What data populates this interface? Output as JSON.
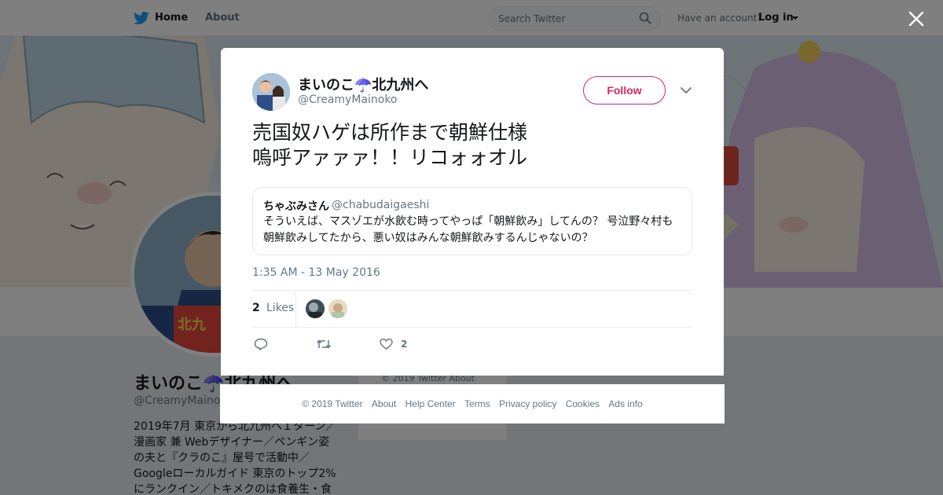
{
  "topnav": {
    "home_label": "Home",
    "about_label": "About",
    "search_placeholder": "Search Twitter",
    "have_account": "Have an account?",
    "login_label": "Log in"
  },
  "profile": {
    "name": "まいのこ☂️北九州へ",
    "handle": "@CreamyMainoko",
    "bio": "2019年7月 東京から北九州へＩターン／漫画家 兼 Webデザイナー／ペンギン姿の夫と『クラのこ』屋号で活動中／Googleローカルガイド 東京のトップ2%にランクイン／トキメクのは食養生・食",
    "footer_text": "© 2019 Twitter   About"
  },
  "tweet": {
    "author_name": "まいのこ☂️北九州へ",
    "author_handle": "@CreamyMainoko",
    "follow_label": "Follow",
    "text": "売国奴ハゲは所作まで朝鮮仕様\n嗚呼アァァァ！！リコォォオル",
    "quote": {
      "name": "ちゃぶみさん",
      "handle": "@chabudaigaeshi",
      "text": "そういえば、マスゾエが水飲む時ってやっぱ「朝鮮飲み」してんの？ 号泣野々村も朝鮮飲みしてたから、悪い奴はみんな朝鮮飲みするんじゃないの？"
    },
    "timestamp": "1:35 AM - 13 May 2016",
    "likes_count": "2",
    "likes_label": "Likes",
    "like_action_count": "2"
  },
  "modal_footer": {
    "copyright": "© 2019 Twitter",
    "about": "About",
    "help_center": "Help Center",
    "terms": "Terms",
    "privacy": "Privacy policy",
    "cookies": "Cookies",
    "ads_info": "Ads info"
  },
  "colors": {
    "accent": "#1da1f2",
    "follow": "#e0245e",
    "muted": "#657786"
  }
}
